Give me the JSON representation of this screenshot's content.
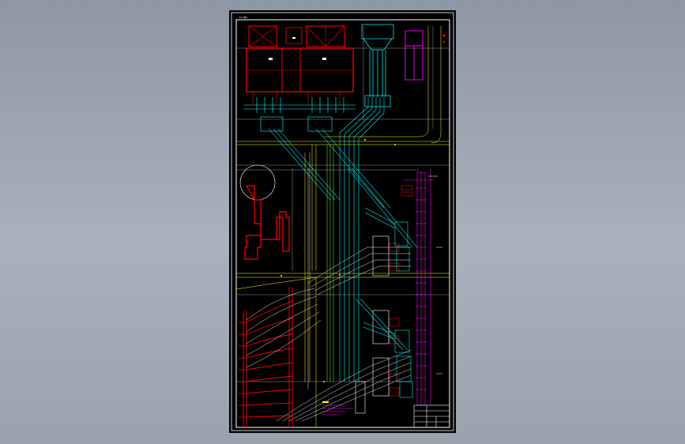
{
  "viewer": {
    "background_top": "#8e97a5",
    "background_bottom": "#aab1bc"
  },
  "drawing": {
    "sheet_color": "#000000",
    "border_color": "#ffffff",
    "colors": {
      "cyan": "#00ffff",
      "red": "#ff0000",
      "yellow": "#ffff00",
      "magenta": "#ff00ff",
      "white": "#ffffff",
      "green": "#00ff00"
    },
    "title_block": {
      "rows": 4,
      "cols": 3
    }
  }
}
